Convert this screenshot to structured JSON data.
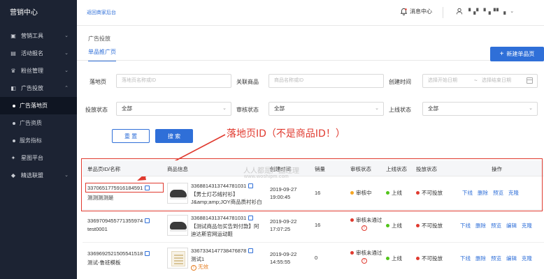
{
  "colors": {
    "accent": "#2f6fd8",
    "sidebar_bg": "#1c2333",
    "annotation": "#e03a2f",
    "status_pending": "#f5a623",
    "status_online": "#52c41a",
    "status_offline": "#e03a2f"
  },
  "header": {
    "brand": "营销中心",
    "back_link": "返回商家后台",
    "messages": "消息中心",
    "user_name": "▝▗▘▝▗▝▘▗"
  },
  "sidebar": {
    "items": [
      {
        "label": "营销工具",
        "icon": "tools-icon"
      },
      {
        "label": "活动报名",
        "icon": "calendar-icon"
      },
      {
        "label": "粉丝管理",
        "icon": "fans-icon"
      },
      {
        "label": "广告投放",
        "icon": "ad-icon"
      }
    ],
    "sub_items": [
      {
        "label": "广告落地页",
        "active": true
      },
      {
        "label": "广告资质",
        "active": false
      },
      {
        "label": "服务指标",
        "active": false
      }
    ],
    "bottom_items": [
      {
        "label": "星图平台",
        "icon": "star-icon"
      },
      {
        "label": "精选联盟",
        "icon": "diamond-icon"
      }
    ]
  },
  "main": {
    "page_title": "广告投放",
    "tab": "单品推广页",
    "new_button": "新建单品页",
    "filters": {
      "landing_label": "落地页",
      "landing_placeholder": "落地页名称或ID",
      "product_label": "关联商品",
      "product_placeholder": "商品名称或ID",
      "created_label": "创建时间",
      "start_placeholder": "选择开始日期",
      "date_sep": "~",
      "end_placeholder": "选择结束日期",
      "delivery_label": "投放状态",
      "delivery_value": "全部",
      "review_label": "审核状态",
      "review_value": "全部",
      "online_label": "上线状态",
      "online_value": "全部",
      "reset": "重 置",
      "search": "搜 索"
    },
    "annotation": "落地页ID（不是商品ID！）",
    "watermark": {
      "line1": "人人都是产品经理",
      "line2": "www.woshipm.com"
    },
    "table": {
      "headers": [
        "单品页ID/名称",
        "商品信息",
        "创建时间",
        "销量",
        "审核状态",
        "上线状态",
        "投放状态",
        "操作"
      ],
      "rows": [
        {
          "id": "3370651775916184591",
          "name": "测测测测是",
          "product_id": "3368814313744781031",
          "product_name": "【男士灯芯绒衬衫】",
          "product_desc": "J&amp;amp;JOY商品质衬衫白",
          "date": "2019-09-27",
          "time": "19:00:45",
          "sales": "16",
          "review": "审核中",
          "review_color": "#f5a623",
          "online": "上线",
          "delivery": "不可投放",
          "ops": [
            "下线",
            "删除",
            "预览",
            "克隆"
          ],
          "thumb": "shoe"
        },
        {
          "id": "3369709455771355974",
          "name": "test0001",
          "product_id": "3368814313744781031",
          "product_name": "【测试商品勿买告到付款】阿",
          "product_desc": "迪达斯官网运动鞋",
          "date": "2019-09-22",
          "time": "17:07:25",
          "sales": "16",
          "review": "审核未通过",
          "review_color": "#e03a2f",
          "online": "上线",
          "delivery": "不可投放",
          "ops": [
            "下线",
            "删除",
            "预览",
            "编辑",
            "克隆"
          ],
          "thumb": "shoe"
        },
        {
          "id": "3369692521505541518",
          "name": "测试-鲁班模板",
          "product_id": "3367334147738476878",
          "product_name": "测试1",
          "product_desc": "无效",
          "date": "2019-09-22",
          "time": "14:55:55",
          "sales": "0",
          "review": "审核未通过",
          "review_color": "#e03a2f",
          "online": "上线",
          "delivery": "不可投放",
          "ops": [
            "下线",
            "删除",
            "预览",
            "编辑",
            "克隆"
          ],
          "thumb": "doc"
        }
      ]
    }
  }
}
